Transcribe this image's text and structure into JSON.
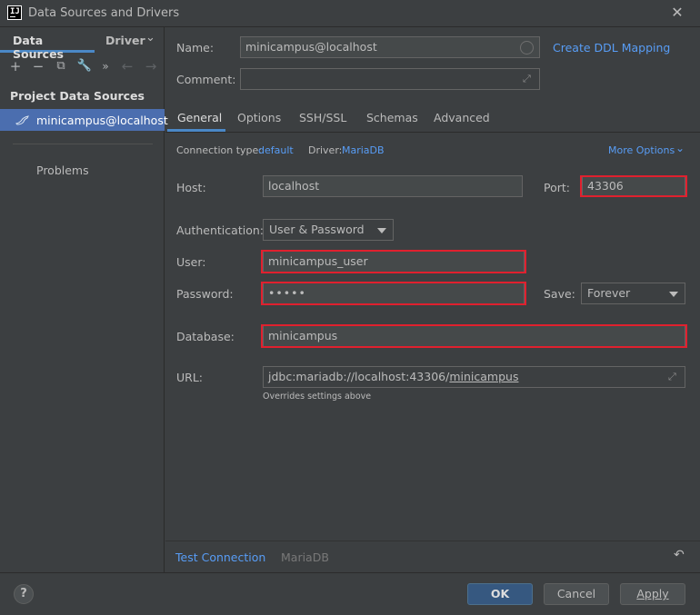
{
  "window": {
    "title": "Data Sources and Drivers",
    "app_icon_text": "IJ"
  },
  "left": {
    "tabs": [
      "Data Sources",
      "Driver"
    ],
    "section_title": "Project Data Sources",
    "selected_item": "minicampus@localhost",
    "problems": "Problems"
  },
  "form": {
    "name_label": "Name:",
    "name_value": "minicampus@localhost",
    "create_ddl_link": "Create DDL Mapping",
    "comment_label": "Comment:",
    "comment_value": "",
    "tabs": [
      "General",
      "Options",
      "SSH/SSL",
      "Schemas",
      "Advanced"
    ],
    "connection_type_label": "Connection type:",
    "connection_type_value": "default",
    "driver_label": "Driver:",
    "driver_value": "MariaDB",
    "more_options": "More Options",
    "host_label": "Host:",
    "host_value": "localhost",
    "port_label": "Port:",
    "port_value": "43306",
    "auth_label": "Authentication:",
    "auth_value": "User & Password",
    "user_label": "User:",
    "user_value": "minicampus_user",
    "password_label": "Password:",
    "password_value": "•••••",
    "save_label": "Save:",
    "save_value": "Forever",
    "database_label": "Database:",
    "database_value": "minicampus",
    "url_label": "URL:",
    "url_prefix": "jdbc:mariadb://localhost:43306/",
    "url_db": "minicampus",
    "url_note": "Overrides settings above"
  },
  "footer": {
    "test_connection": "Test Connection",
    "driver_name": "MariaDB"
  },
  "buttons": {
    "help": "?",
    "ok": "OK",
    "cancel": "Cancel",
    "apply": "Apply"
  },
  "colors": {
    "accent": "#4a88c7",
    "link": "#589df6",
    "highlight": "#e0202e",
    "selection": "#4b6eaf"
  }
}
